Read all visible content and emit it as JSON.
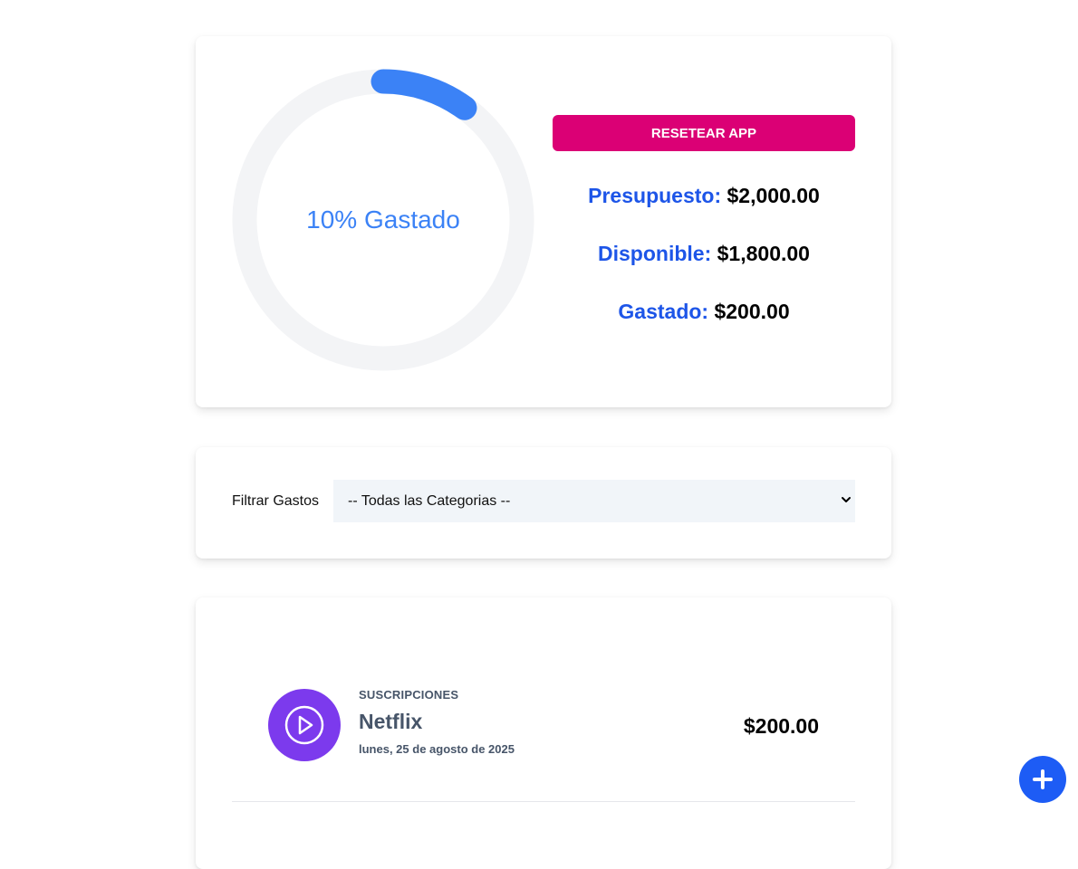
{
  "budget": {
    "percent_spent": 10,
    "progress_text": "10% Gastado",
    "progress_color": "#3b82f6",
    "track_color": "#f3f4f6",
    "reset_label": "RESETEAR APP",
    "reset_color": "#db0075",
    "lines": [
      {
        "label": "Presupuesto:",
        "value": "$2,000.00"
      },
      {
        "label": "Disponible:",
        "value": "$1,800.00"
      },
      {
        "label": "Gastado:",
        "value": "$200.00"
      }
    ]
  },
  "filter": {
    "label": "Filtrar Gastos",
    "selected": "-- Todas las Categorias --"
  },
  "expenses": [
    {
      "category": "SUSCRIPCIONES",
      "name": "Netflix",
      "date": "lunes, 25 de agosto de 2025",
      "amount": "$200.00",
      "icon": "play-circle-icon",
      "icon_color": "#7c3aed"
    }
  ],
  "fab": {
    "icon": "plus-icon",
    "color": "#1d5cf5"
  }
}
